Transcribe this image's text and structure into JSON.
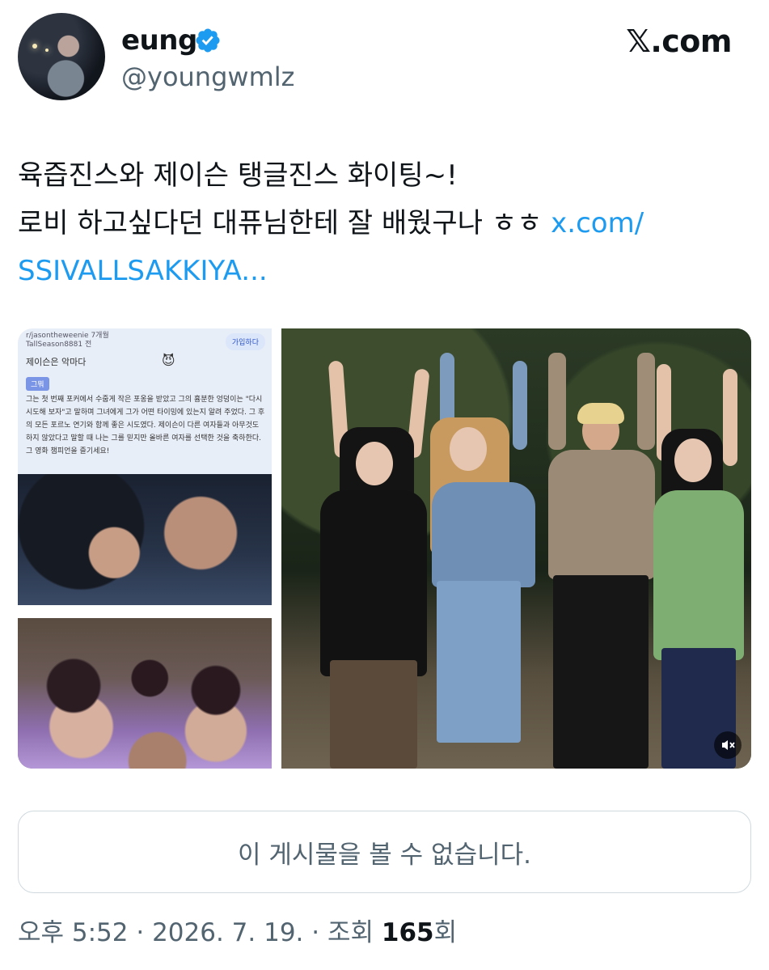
{
  "author": {
    "display_name": "eung",
    "handle": "@youngwmlz",
    "verified_icon": "verified-badge-icon"
  },
  "brand": "𝕏.com",
  "tweet": {
    "line1": "육즙진스와 제이슨 탱글진스 화이팅~!",
    "line2_text": "로비 하고싶다던 대퓨님한테 잘 배웠구나 ㅎㅎ ",
    "line2_link": "x.com/",
    "line3_link": "SSIVALLSAKKIYA..."
  },
  "media": {
    "reddit": {
      "header_line1": "r/jasontheweenie 7개월",
      "header_line2": "TallSeason8881 전",
      "join_label": "가입하다",
      "title": "제이슨은 악마다",
      "emoji": "😈",
      "tag": "그뭐",
      "body": "그는 첫 번째 포커에서 수줍게 작은 포옹을 받았고 그의 흉분한 엉덩이는 \"다시 시도해 보자\"고 말하며 그녀에게 그가 어떤 타이밍에 있는지 알려 주었다. 그 후의 모든 포르노 연기와 함께 좋은 시도였다. 제이슨이 다른 여자들과 아무것도 하지 않았다고 말할 때 나는 그를 믿지만 올바른 여자를 선택한 것을 축하한다. 그 영화 챔피언을 즐기세요!"
    },
    "mute_icon": "muted-speaker-icon"
  },
  "unavailable_text": "이 게시물을 볼 수 없습니다.",
  "meta": {
    "time": "오후 5:52",
    "sep1": " · ",
    "date": "2026. 7. 19.",
    "sep2": " · ",
    "views_prefix": "조회 ",
    "views_count": "165",
    "views_suffix": "회"
  },
  "colors": {
    "link": "#1d9bf0",
    "secondary_text": "#536471",
    "verified": "#1d9bf0"
  }
}
